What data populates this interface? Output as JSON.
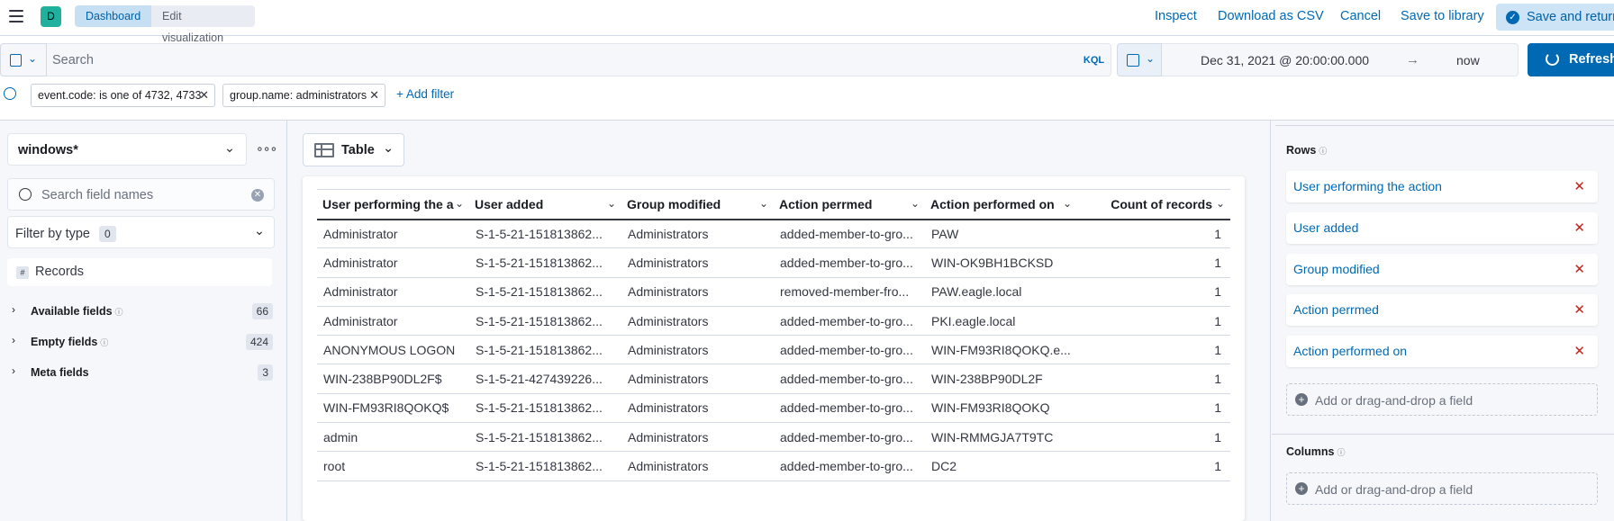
{
  "header": {
    "app_initial": "D",
    "breadcrumbs": [
      "Dashboard",
      "Edit visualization"
    ],
    "actions": {
      "inspect": "Inspect",
      "download_csv": "Download as CSV",
      "cancel": "Cancel",
      "save_library": "Save to library",
      "save_return": "Save and return"
    }
  },
  "query": {
    "search_placeholder": "Search",
    "language": "KQL",
    "date_start": "Dec 31, 2021 @ 20:00:00.000",
    "date_arrow": "→",
    "date_end": "now",
    "refresh": "Refresh"
  },
  "filters": {
    "pills": [
      "event.code: is one of 4732, 4733",
      "group.name: administrators"
    ],
    "add_filter": "+ Add filter"
  },
  "field_list": {
    "index_pattern": "windows*",
    "search_placeholder": "Search field names",
    "filter_by_type": "Filter by type",
    "filter_by_type_count": "0",
    "records_label": "Records",
    "groups": [
      {
        "label": "Available fields",
        "count": "66"
      },
      {
        "label": "Empty fields",
        "count": "424"
      },
      {
        "label": "Meta fields",
        "count": "3"
      }
    ]
  },
  "visualization": {
    "type_label": "Table"
  },
  "table": {
    "columns": [
      "User performing the a",
      "User added",
      "Group modified",
      "Action perrmed",
      "Action performed on",
      "Count of records"
    ],
    "rows": [
      [
        "Administrator",
        "S-1-5-21-151813862...",
        "Administrators",
        "added-member-to-gro...",
        "PAW",
        "1"
      ],
      [
        "Administrator",
        "S-1-5-21-151813862...",
        "Administrators",
        "added-member-to-gro...",
        "WIN-OK9BH1BCKSD",
        "1"
      ],
      [
        "Administrator",
        "S-1-5-21-151813862...",
        "Administrators",
        "removed-member-fro...",
        "PAW.eagle.local",
        "1"
      ],
      [
        "Administrator",
        "S-1-5-21-151813862...",
        "Administrators",
        "added-member-to-gro...",
        "PKI.eagle.local",
        "1"
      ],
      [
        "ANONYMOUS LOGON",
        "S-1-5-21-151813862...",
        "Administrators",
        "added-member-to-gro...",
        "WIN-FM93RI8QOKQ.e...",
        "1"
      ],
      [
        "WIN-238BP90DL2F$",
        "S-1-5-21-427439226...",
        "Administrators",
        "added-member-to-gro...",
        "WIN-238BP90DL2F",
        "1"
      ],
      [
        "WIN-FM93RI8QOKQ$",
        "S-1-5-21-151813862...",
        "Administrators",
        "added-member-to-gro...",
        "WIN-FM93RI8QOKQ",
        "1"
      ],
      [
        "admin",
        "S-1-5-21-151813862...",
        "Administrators",
        "added-member-to-gro...",
        "WIN-RMMGJA7T9TC",
        "1"
      ],
      [
        "root",
        "S-1-5-21-151813862...",
        "Administrators",
        "added-member-to-gro...",
        "DC2",
        "1"
      ]
    ]
  },
  "config": {
    "rows_title": "Rows",
    "rows": [
      "User performing the action",
      "User added",
      "Group modified",
      "Action perrmed",
      "Action performed on"
    ],
    "add_field": "Add or drag-and-drop a field",
    "columns_title": "Columns"
  },
  "colors": {
    "accent": "#0069b4",
    "app_badge": "#20b09e",
    "remove": "#bd271e"
  }
}
